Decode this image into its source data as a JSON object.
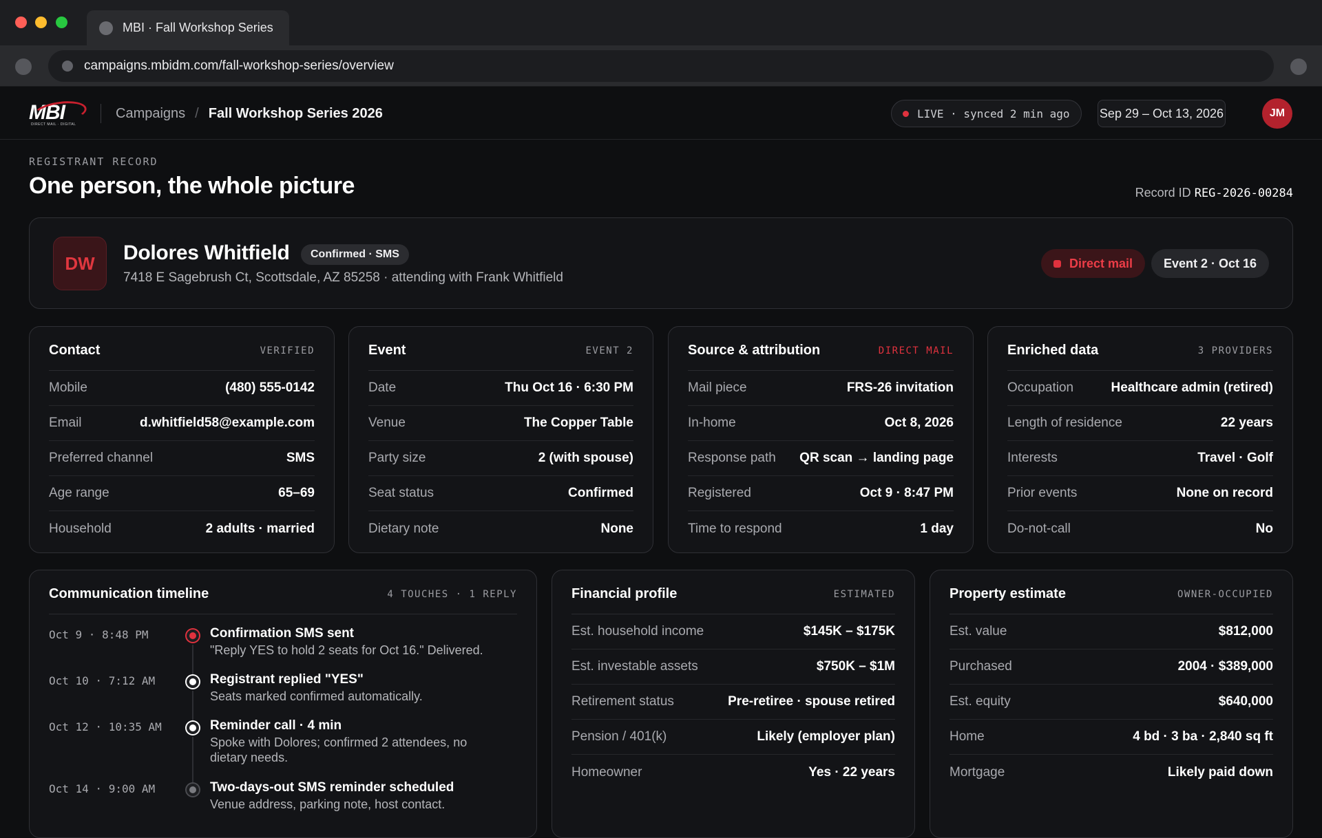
{
  "browser": {
    "tab_title": "MBI · Fall Workshop Series",
    "url": "campaigns.mbidm.com/fall-workshop-series/overview"
  },
  "header": {
    "logo_text": "MBI",
    "logo_tagline": "DIRECT MAIL · DIGITAL",
    "breadcrumb_parent": "Campaigns",
    "breadcrumb_separator": "/",
    "breadcrumb_current": "Fall Workshop Series 2026",
    "live_status": "LIVE · synced 2 min ago",
    "date_range": "Sep 29 – Oct 13, 2026",
    "user_initials": "JM"
  },
  "page": {
    "eyebrow": "REGISTRANT RECORD",
    "title": "One person, the whole picture",
    "record_id_label": "Record ID",
    "record_id": "REG-2026-00284"
  },
  "person": {
    "initials": "DW",
    "name": "Dolores Whitfield",
    "status": "Confirmed · SMS",
    "address": "7418 E Sagebrush Ct, Scottsdale, AZ 85258 · attending with Frank Whitfield",
    "source": "Direct mail",
    "event": "Event 2 · Oct 16"
  },
  "contact": {
    "title": "Contact",
    "tag": "VERIFIED",
    "rows": [
      {
        "k": "Mobile",
        "v": "(480) 555-0142"
      },
      {
        "k": "Email",
        "v": "d.whitfield58@example.com"
      },
      {
        "k": "Preferred channel",
        "v": "SMS"
      },
      {
        "k": "Age range",
        "v": "65–69"
      },
      {
        "k": "Household",
        "v": "2 adults · married"
      }
    ]
  },
  "event": {
    "title": "Event",
    "tag": "EVENT 2",
    "rows": [
      {
        "k": "Date",
        "v": "Thu Oct 16 · 6:30 PM"
      },
      {
        "k": "Venue",
        "v": "The Copper Table"
      },
      {
        "k": "Party size",
        "v": "2 (with spouse)"
      },
      {
        "k": "Seat status",
        "v": "Confirmed"
      },
      {
        "k": "Dietary note",
        "v": "None"
      }
    ]
  },
  "source": {
    "title": "Source & attribution",
    "tag": "DIRECT MAIL",
    "rows": [
      {
        "k": "Mail piece",
        "v": "FRS-26 invitation"
      },
      {
        "k": "In-home",
        "v": "Oct 8, 2026"
      },
      {
        "k": "Response path",
        "v": "QR scan → landing page"
      },
      {
        "k": "Registered",
        "v": "Oct 9 · 8:47 PM"
      },
      {
        "k": "Time to respond",
        "v": "1 day"
      }
    ]
  },
  "enriched": {
    "title": "Enriched data",
    "tag": "3 PROVIDERS",
    "rows": [
      {
        "k": "Occupation",
        "v": "Healthcare admin (retired)"
      },
      {
        "k": "Length of residence",
        "v": "22 years"
      },
      {
        "k": "Interests",
        "v": "Travel · Golf"
      },
      {
        "k": "Prior events",
        "v": "None on record"
      },
      {
        "k": "Do-not-call",
        "v": "No"
      }
    ]
  },
  "timeline": {
    "title": "Communication timeline",
    "tag": "4 TOUCHES · 1 REPLY",
    "items": [
      {
        "time": "Oct 9 · 8:48 PM",
        "title": "Confirmation SMS sent",
        "body": "\"Reply YES to hold 2 seats for Oct 16.\" Delivered."
      },
      {
        "time": "Oct 10 · 7:12 AM",
        "title": "Registrant replied \"YES\"",
        "body": "Seats marked confirmed automatically."
      },
      {
        "time": "Oct 12 · 10:35 AM",
        "title": "Reminder call · 4 min",
        "body": "Spoke with Dolores; confirmed 2 attendees, no dietary needs."
      },
      {
        "time": "Oct 14 · 9:00 AM",
        "title": "Two-days-out SMS reminder scheduled",
        "body": "Venue address, parking note, host contact."
      }
    ]
  },
  "financial": {
    "title": "Financial profile",
    "tag": "ESTIMATED",
    "rows": [
      {
        "k": "Est. household income",
        "v": "$145K – $175K"
      },
      {
        "k": "Est. investable assets",
        "v": "$750K – $1M"
      },
      {
        "k": "Retirement status",
        "v": "Pre-retiree · spouse retired"
      },
      {
        "k": "Pension / 401(k)",
        "v": "Likely (employer plan)"
      },
      {
        "k": "Homeowner",
        "v": "Yes · 22 years"
      }
    ]
  },
  "property": {
    "title": "Property estimate",
    "tag": "OWNER-OCCUPIED",
    "rows": [
      {
        "k": "Est. value",
        "v": "$812,000"
      },
      {
        "k": "Purchased",
        "v": "2004 · $389,000"
      },
      {
        "k": "Est. equity",
        "v": "$640,000"
      },
      {
        "k": "Home",
        "v": "4 bd · 3 ba · 2,840 sq ft"
      },
      {
        "k": "Mortgage",
        "v": "Likely paid down"
      }
    ]
  }
}
